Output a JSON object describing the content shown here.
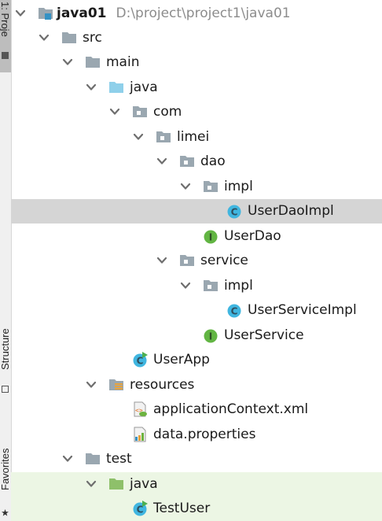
{
  "stripe": {
    "top_label": "1: Proje",
    "structure_label": "Structure",
    "favorites_label": "Favorites"
  },
  "tree": {
    "root": {
      "name": "java01",
      "path": "D:\\project\\project1\\java01"
    },
    "src": "src",
    "main": "main",
    "java": "java",
    "com": "com",
    "limei": "limei",
    "dao": "dao",
    "dao_impl": "impl",
    "user_dao_impl": "UserDaoImpl",
    "user_dao": "UserDao",
    "service": "service",
    "service_impl": "impl",
    "user_service_impl": "UserServiceImpl",
    "user_service": "UserService",
    "user_app": "UserApp",
    "resources": "resources",
    "app_context": "applicationContext.xml",
    "data_properties": "data.properties",
    "test": "test",
    "test_java": "java",
    "test_user": "TestUser"
  },
  "colors": {
    "selection": "#d5d5d5",
    "test_source_bg": "#ecf6e4",
    "folder_gray": "#9aa7b0",
    "source_folder_blue": "#8fd0ea",
    "test_folder_green": "#8ec06a",
    "class_icon": "#40b6e0",
    "interface_icon": "#62b543"
  },
  "icons": {
    "expanded": "chevron-down-icon",
    "module": "module-folder-icon",
    "folder": "folder-icon",
    "source_root": "source-folder-icon",
    "package": "package-icon",
    "class": "class-icon",
    "interface": "interface-icon",
    "runnable_class": "runnable-class-icon",
    "resources_root": "resources-folder-icon",
    "xml_file": "xml-file-icon",
    "properties_file": "properties-file-icon",
    "test_root": "test-folder-icon"
  }
}
